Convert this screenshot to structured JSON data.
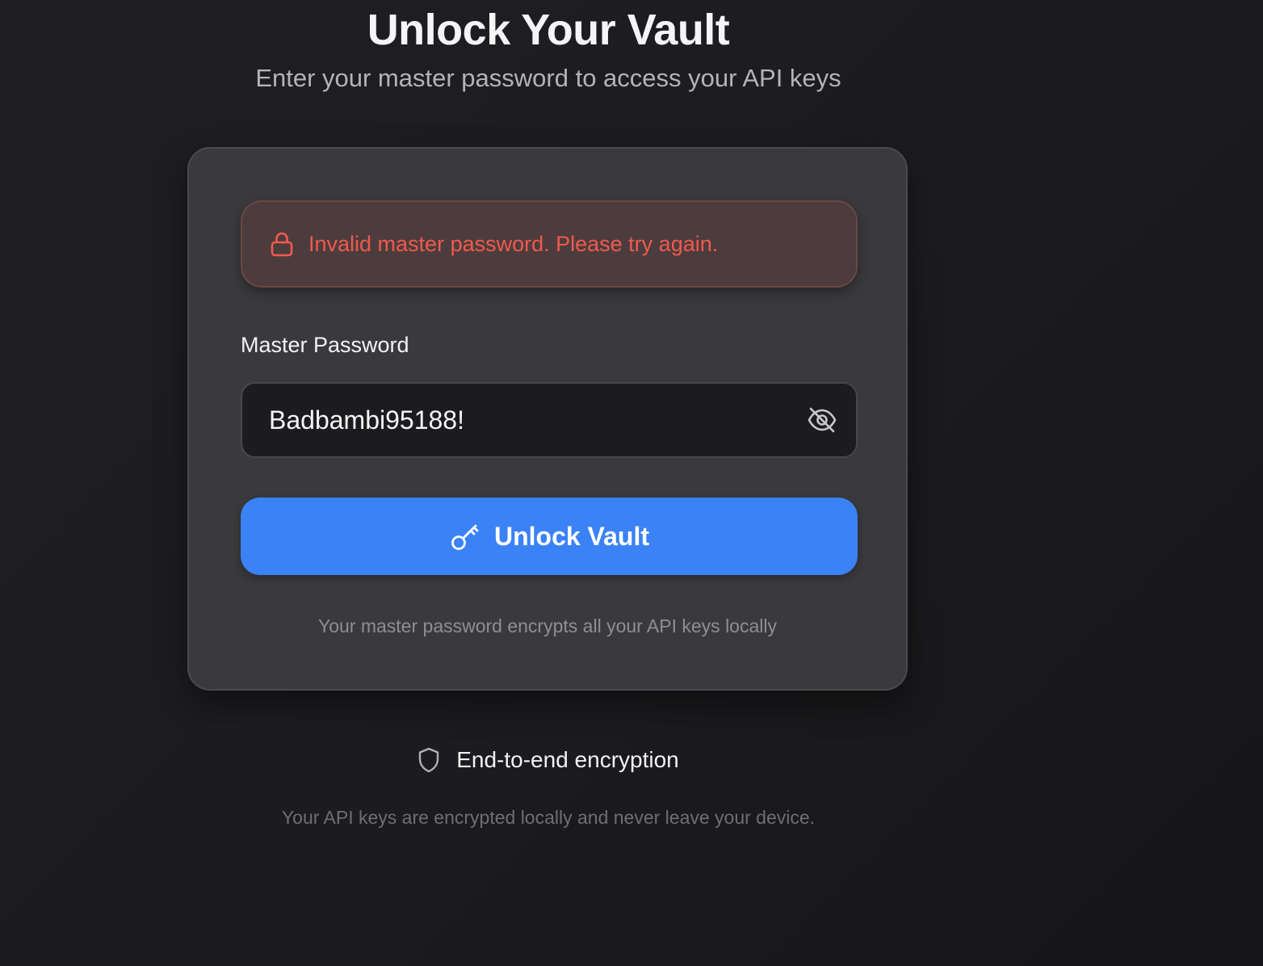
{
  "header": {
    "title": "Unlock Your Vault",
    "subtitle": "Enter your master password to access your API keys"
  },
  "card": {
    "error": {
      "icon": "lock-icon",
      "message": "Invalid master password. Please try again."
    },
    "password_field": {
      "label": "Master Password",
      "value": "Badbambi95188!",
      "visibility_icon": "eye-off-icon"
    },
    "unlock_button": {
      "icon": "key-icon",
      "label": "Unlock Vault"
    },
    "footnote": "Your master password encrypts all your API keys locally"
  },
  "security": {
    "icon": "shield-icon",
    "label": "End-to-end encryption",
    "note": "Your API keys are encrypted locally and never leave your device."
  },
  "colors": {
    "accent": "#3b82f6",
    "error_text": "#ef5a4e",
    "error_background": "#4d3c3d",
    "card_background": "#3a3a3d",
    "page_background": "#1c1c1f"
  }
}
